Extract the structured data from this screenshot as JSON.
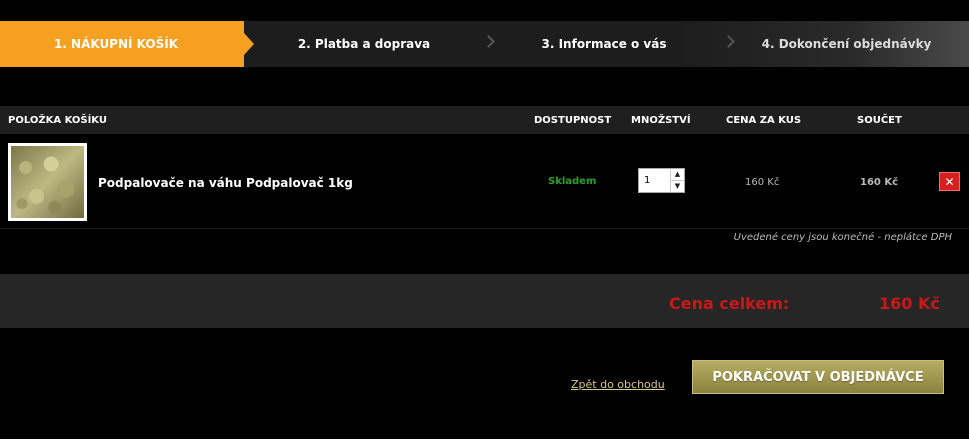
{
  "steps": [
    {
      "label": "1. NÁKUPNÍ KOŠÍK",
      "active": true
    },
    {
      "label": "2. Platba a doprava",
      "active": false
    },
    {
      "label": "3. Informace o vás",
      "active": false
    },
    {
      "label": "4. Dokončení objednávky",
      "active": false
    }
  ],
  "cart": {
    "headers": {
      "item": "POLOŽKA KOŠÍKU",
      "availability": "DOSTUPNOST",
      "quantity": "MNOŽSTVÍ",
      "unit_price": "CENA ZA KUS",
      "total": "SOUČET"
    },
    "items": [
      {
        "name": "Podpalovače na váhu Podpalovač 1kg",
        "availability": "Skladem",
        "quantity": "1",
        "unit_price": "160 Kč",
        "total": "160 Kč",
        "remove_label": "✕"
      }
    ],
    "note": "Uvedené ceny jsou konečné - neplátce DPH"
  },
  "summary": {
    "total_label": "Cena celkem:",
    "total_value": "160 Kč"
  },
  "actions": {
    "back_label": "Zpět do obchodu",
    "continue_label": "POKRAČOVAT V OBJEDNÁVCE"
  },
  "colors": {
    "accent": "#f5a020",
    "total": "#c81818",
    "in_stock": "#2ca02c",
    "button": "#a39b52"
  },
  "icons": {
    "step_separator": "chevron-right-icon",
    "remove": "close-icon",
    "spin_up": "caret-up-icon",
    "spin_down": "caret-down-icon"
  }
}
